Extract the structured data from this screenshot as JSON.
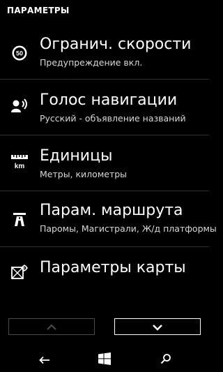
{
  "header": {
    "title": "ПАРАМЕТРЫ"
  },
  "items": [
    {
      "icon": "speed-limit-icon",
      "title": "Огранич. скорости",
      "subtitle": "Предупреждение вкл.",
      "badge": "50"
    },
    {
      "icon": "voice-icon",
      "title": "Голос навигации",
      "subtitle": "Русский - объявление названий"
    },
    {
      "icon": "units-icon",
      "title": "Единицы",
      "subtitle": "Метры, километры",
      "icon_text": "km"
    },
    {
      "icon": "route-icon",
      "title": "Парам. маршрута",
      "subtitle": "Паромы, Магистрали, Ж/д платформы"
    },
    {
      "icon": "map-settings-icon",
      "title": "Параметры карты",
      "subtitle": ""
    }
  ],
  "navigation": {
    "up_icon": "chevron-up-icon",
    "down_icon": "chevron-down-icon"
  },
  "softkeys": {
    "back_icon": "back-arrow-icon",
    "start_icon": "windows-start-icon",
    "search_icon": "search-icon"
  },
  "colors": {
    "background": "#000000",
    "text": "#ffffff",
    "divider": "#2e2e2e",
    "disabled_border": "#4a4a4a"
  }
}
